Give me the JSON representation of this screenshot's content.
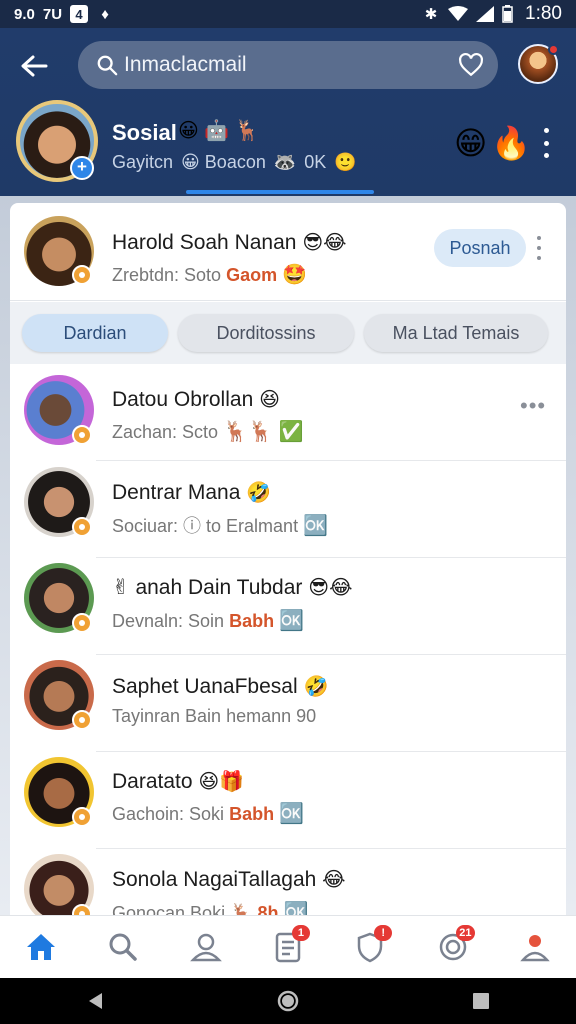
{
  "status_bar": {
    "left_items": [
      "9.0",
      "7U",
      "4",
      "♦"
    ],
    "time": "1:80"
  },
  "header": {
    "search_placeholder": "Inmaclacmail",
    "profile": {
      "name": "Sosial",
      "name_emojis": "😀 🤖 🦌",
      "stat1": "Gayitcn",
      "stat2": "😀 Boacon",
      "stat3": "🦝",
      "stat4": "0K",
      "stat5": "🙂"
    },
    "right_emojis": [
      "😁",
      "🔥"
    ]
  },
  "featured": {
    "name": "Harold Soah Nanan",
    "name_emojis": "😎😂",
    "sub_text": "Zrebtdn: Soto",
    "sub_accent": "Gaom",
    "sub_emoji": "🤩",
    "button_label": "Posnah"
  },
  "tabs": [
    "Dardian",
    "Dorditossins",
    "Ma Ltad Temais"
  ],
  "chats": [
    {
      "name": "Datou Obrollan",
      "name_emojis": "😆",
      "sub_text": "Zachan: Scto",
      "sub_accent": "",
      "sub_emojis": "🦌🦌 ✅",
      "more": "•••"
    },
    {
      "name": "Dentrar Mana",
      "name_emojis": "🤣",
      "sub_text": "Sociuar: ⓘ to Eralmant",
      "sub_accent": "",
      "sub_emojis": "🆗",
      "more": ""
    },
    {
      "name": "anah Dain Tubdar",
      "name_emojis": "😎😂",
      "name_prefix": "✌",
      "sub_text": "Devnaln: Soin",
      "sub_accent": "Babh",
      "sub_emojis": "🆗",
      "more": ""
    },
    {
      "name": "Saphet UanaFbesal",
      "name_emojis": "🤣",
      "sub_text": "Tayinran Bain hemann",
      "sub_accent": "",
      "sub_emojis": "90",
      "more": ""
    },
    {
      "name": "Daratato",
      "name_emojis": "😆🎁",
      "sub_text": "Gachoin: Soki",
      "sub_accent": "Babh",
      "sub_emojis": "🆗",
      "more": ""
    },
    {
      "name": "Sonola NagaiTallagah",
      "name_emojis": "😂",
      "sub_text": "Gonocan Boki",
      "sub_accent": "🦌 8h",
      "sub_emojis": "🆗",
      "more": ""
    }
  ],
  "bottom_nav": {
    "badge_docs": "1",
    "badge_shield": "!",
    "badge_notif": "21"
  },
  "colors": {
    "header_bg": "#213c6b",
    "accent_blue": "#2f86e8",
    "accent_orange": "#d4552b",
    "badge_red": "#e53935"
  }
}
